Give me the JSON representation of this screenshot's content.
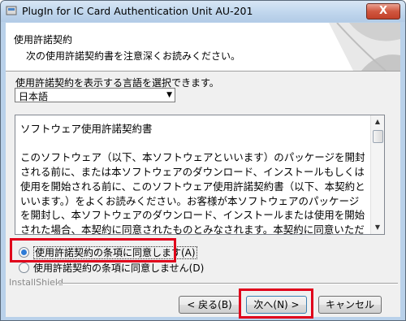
{
  "window": {
    "title": "PlugIn for IC Card Authentication Unit AU-201",
    "close_label": "X"
  },
  "header": {
    "title": "使用許諾契約",
    "subtitle": "次の使用許諾契約書を注意深くお読みください。"
  },
  "language": {
    "label": "使用許諾契約を表示する言語を選択できます。",
    "selected": "日本語"
  },
  "license": {
    "text": "ソフトウェア使用許諾契約書\n\nこのソフトウェア（以下、本ソフトウェアといいます）のパッケージを開封される前に、または本ソフトウェアのダウンロード、インストールもしくは使用を開始される前に、このソフトウェア使用許諾契約書（以下、本契約といいます。）をよくお読みください。お客様が本ソフトウェアのパッケージを開封し、本ソフトウェアのダウンロード、インストールまたは使用を開始された場合、本契約に同意されたものとみなされます。本契約に同意いただけない場合は、本ソフトウェアのパッケー"
  },
  "options": {
    "accept": "使用許諾契約の条項に同意します(A)",
    "decline": "使用許諾契約の条項に同意しません(D)",
    "selected": "accept"
  },
  "footer": {
    "installshield": "InstallShield",
    "back_label": "< 戻る(B)",
    "next_label": "次へ(N) >",
    "cancel_label": "キャンセル"
  },
  "highlight_color": "#e0001b"
}
